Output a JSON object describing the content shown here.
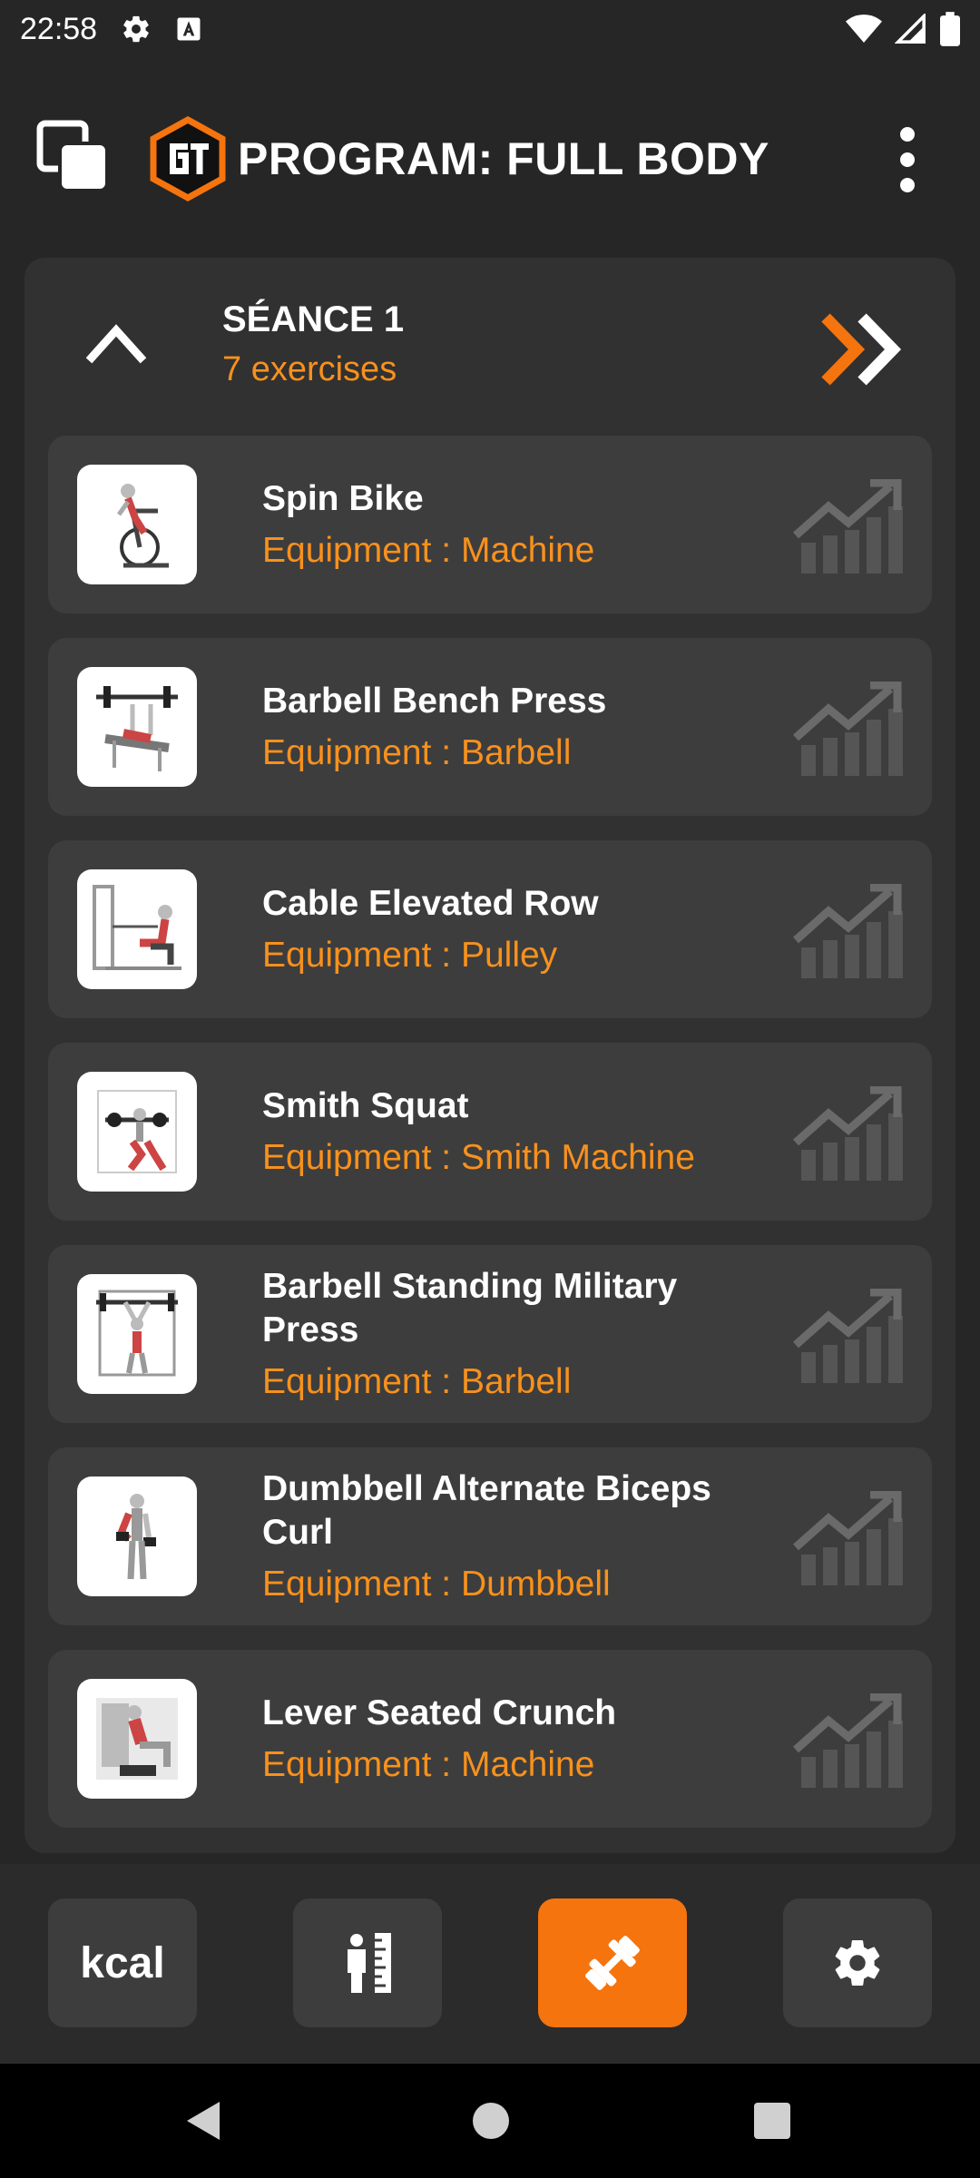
{
  "status_bar": {
    "time": "22:58",
    "icons": [
      "gear-icon",
      "font-a-icon",
      "wifi-icon",
      "signal-icon",
      "battery-icon"
    ]
  },
  "app_bar": {
    "title": "PROGRAM: FULL BODY",
    "logo_text": "GT"
  },
  "session": {
    "title": "SÉANCE 1",
    "count": "7 exercises"
  },
  "exercises": [
    {
      "name": "Spin Bike",
      "equipment": "Equipment : Machine"
    },
    {
      "name": "Barbell Bench Press",
      "equipment": "Equipment : Barbell"
    },
    {
      "name": "Cable Elevated Row",
      "equipment": "Equipment : Pulley"
    },
    {
      "name": "Smith Squat",
      "equipment": "Equipment : Smith Machine"
    },
    {
      "name": "Barbell Standing Military Press",
      "equipment": "Equipment : Barbell"
    },
    {
      "name": "Dumbbell Alternate Biceps Curl",
      "equipment": "Equipment : Dumbbell"
    },
    {
      "name": "Lever Seated Crunch",
      "equipment": "Equipment : Machine"
    }
  ],
  "bottom_nav": {
    "kcal_label": "kcal",
    "active_tab": "workout"
  },
  "colors": {
    "accent": "#f7911d",
    "active_nav": "#f5740e",
    "background": "#262626",
    "card": "#313131",
    "row": "#3d3d3d"
  }
}
